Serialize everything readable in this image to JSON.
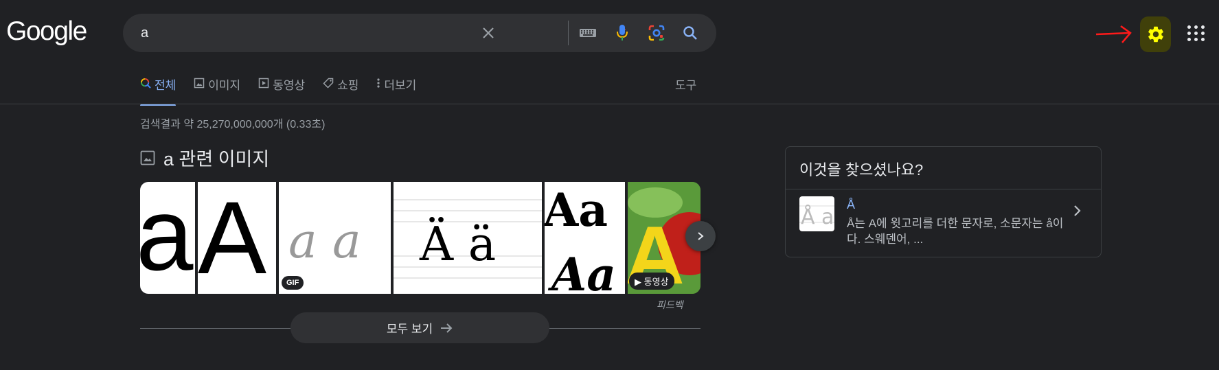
{
  "header": {
    "logo_text": "Google",
    "search_value": "a",
    "icons": [
      "clear-icon",
      "keyboard-icon",
      "mic-icon",
      "lens-icon",
      "search-icon"
    ],
    "settings_icon": "gear-icon",
    "apps_icon": "apps-grid-icon",
    "annotation_color": "#ff1a1a",
    "settings_highlight_color": "#ffff00"
  },
  "tabs": [
    {
      "label": "전체",
      "icon": "search-icon",
      "active": true
    },
    {
      "label": "이미지",
      "icon": "image-icon",
      "active": false
    },
    {
      "label": "동영상",
      "icon": "video-icon",
      "active": false
    },
    {
      "label": "쇼핑",
      "icon": "tag-icon",
      "active": false
    },
    {
      "label": "더보기",
      "icon": "more-vert-icon",
      "active": false
    }
  ],
  "tools_label": "도구",
  "result_stats": "검색결과 약 25,270,000,000개 (0.33초)",
  "images_section": {
    "title": "a 관련 이미지",
    "thumbs": [
      {
        "glyph": "a",
        "badge": ""
      },
      {
        "glyph": "A",
        "badge": ""
      },
      {
        "glyph": "a a",
        "badge": "GIF"
      },
      {
        "glyph": "Ä ä",
        "badge": ""
      },
      {
        "glyph": "Aa Aa",
        "badge": ""
      },
      {
        "glyph": "A",
        "badge": "동영상"
      }
    ],
    "feedback": "피드백",
    "view_all": "모두 보기"
  },
  "side_card": {
    "title": "이것을 찾으셨나요?",
    "item_name": "Å",
    "item_desc": "Å는 A에 윗고리를 더한 문자로, 소문자는 å이다. 스웨덴어, ...",
    "thumb_glyph": "Å a"
  },
  "colors": {
    "background": "#202124",
    "link": "#8ab4f8",
    "text": "#bdc1c6",
    "muted": "#9aa0a6"
  }
}
